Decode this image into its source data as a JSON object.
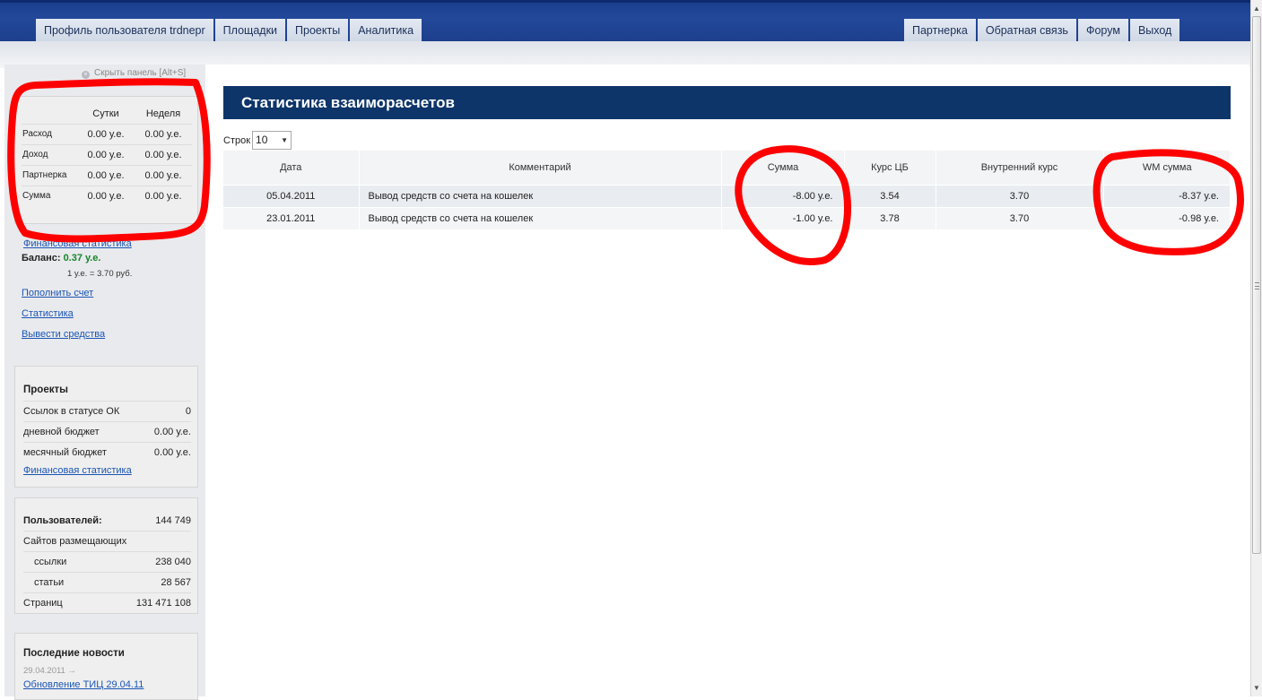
{
  "header": {
    "nav_left": [
      "Профиль пользователя trdnepr",
      "Площадки",
      "Проекты",
      "Аналитика"
    ],
    "nav_right": [
      "Партнерка",
      "Обратная связь",
      "Форум",
      "Выход"
    ]
  },
  "sidebar": {
    "hide_panel": "Скрыть панель [Alt+S]",
    "finance": {
      "headers": [
        "",
        "Сутки",
        "Неделя"
      ],
      "rows": [
        {
          "label": "Расход",
          "day": "0.00 у.е.",
          "week": "0.00 у.е."
        },
        {
          "label": "Доход",
          "day": "0.00 у.е.",
          "week": "0.00 у.е."
        },
        {
          "label": "Партнерка",
          "day": "0.00 у.е.",
          "week": "0.00 у.е."
        },
        {
          "label": "Сумма",
          "day": "0.00 у.е.",
          "week": "0.00 у.е."
        }
      ],
      "link": "Финансовая статистика"
    },
    "balance_label": "Баланс:",
    "balance_value": "0.37 у.е.",
    "rate": "1 у.е. = 3.70 руб.",
    "links": [
      "Пополнить счет",
      "Статистика",
      "Вывести средства"
    ],
    "projects": {
      "title": "Проекты",
      "rows": [
        {
          "k": "Ссылок в статусе ОК",
          "v": "0"
        },
        {
          "k": "дневной бюджет",
          "v": "0.00 у.е."
        },
        {
          "k": "месячный бюджет",
          "v": "0.00 у.е."
        }
      ],
      "link": "Финансовая статистика"
    },
    "stats": {
      "rows": [
        {
          "k": "Пользователей:",
          "v": "144 749"
        },
        {
          "k": "Сайтов размещающих",
          "v": ""
        },
        {
          "k": "ссылки",
          "v": "238 040"
        },
        {
          "k": "статьи",
          "v": "28 567"
        },
        {
          "k": "Страниц",
          "v": "131 471 108"
        }
      ]
    },
    "news": {
      "title": "Последние новости",
      "date": "29.04.2011",
      "date_arrow": "→",
      "link": "Обновление ТИЦ 29.04.11"
    }
  },
  "main": {
    "title": "Статистика взаиморасчетов",
    "rows_label": "Строк",
    "rows_value": "10",
    "columns": [
      "Дата",
      "Комментарий",
      "Сумма",
      "Курс ЦБ",
      "Внутренний курс",
      "WM сумма"
    ],
    "rows": [
      {
        "date": "05.04.2011",
        "comment": "Вывод средств со счета на кошелек",
        "sum": "-8.00 у.е.",
        "cb": "3.54",
        "inner": "3.70",
        "wm": "-8.37 у.е."
      },
      {
        "date": "23.01.2011",
        "comment": "Вывод средств со счета на кошелек",
        "sum": "-1.00 у.е.",
        "cb": "3.78",
        "inner": "3.70",
        "wm": "-0.98 у.е."
      }
    ]
  },
  "colors": {
    "header_blue": "#1b3f8e",
    "title_bar": "#0d3569",
    "link": "#1a55b5",
    "balance_green": "#14862a",
    "annotation_red": "#ff0000"
  },
  "icons": {
    "hide_panel": "close-circle-icon",
    "select_arrow": "chevron-down-icon",
    "scroll_up": "arrow-up-icon",
    "scroll_down": "arrow-down-icon"
  }
}
